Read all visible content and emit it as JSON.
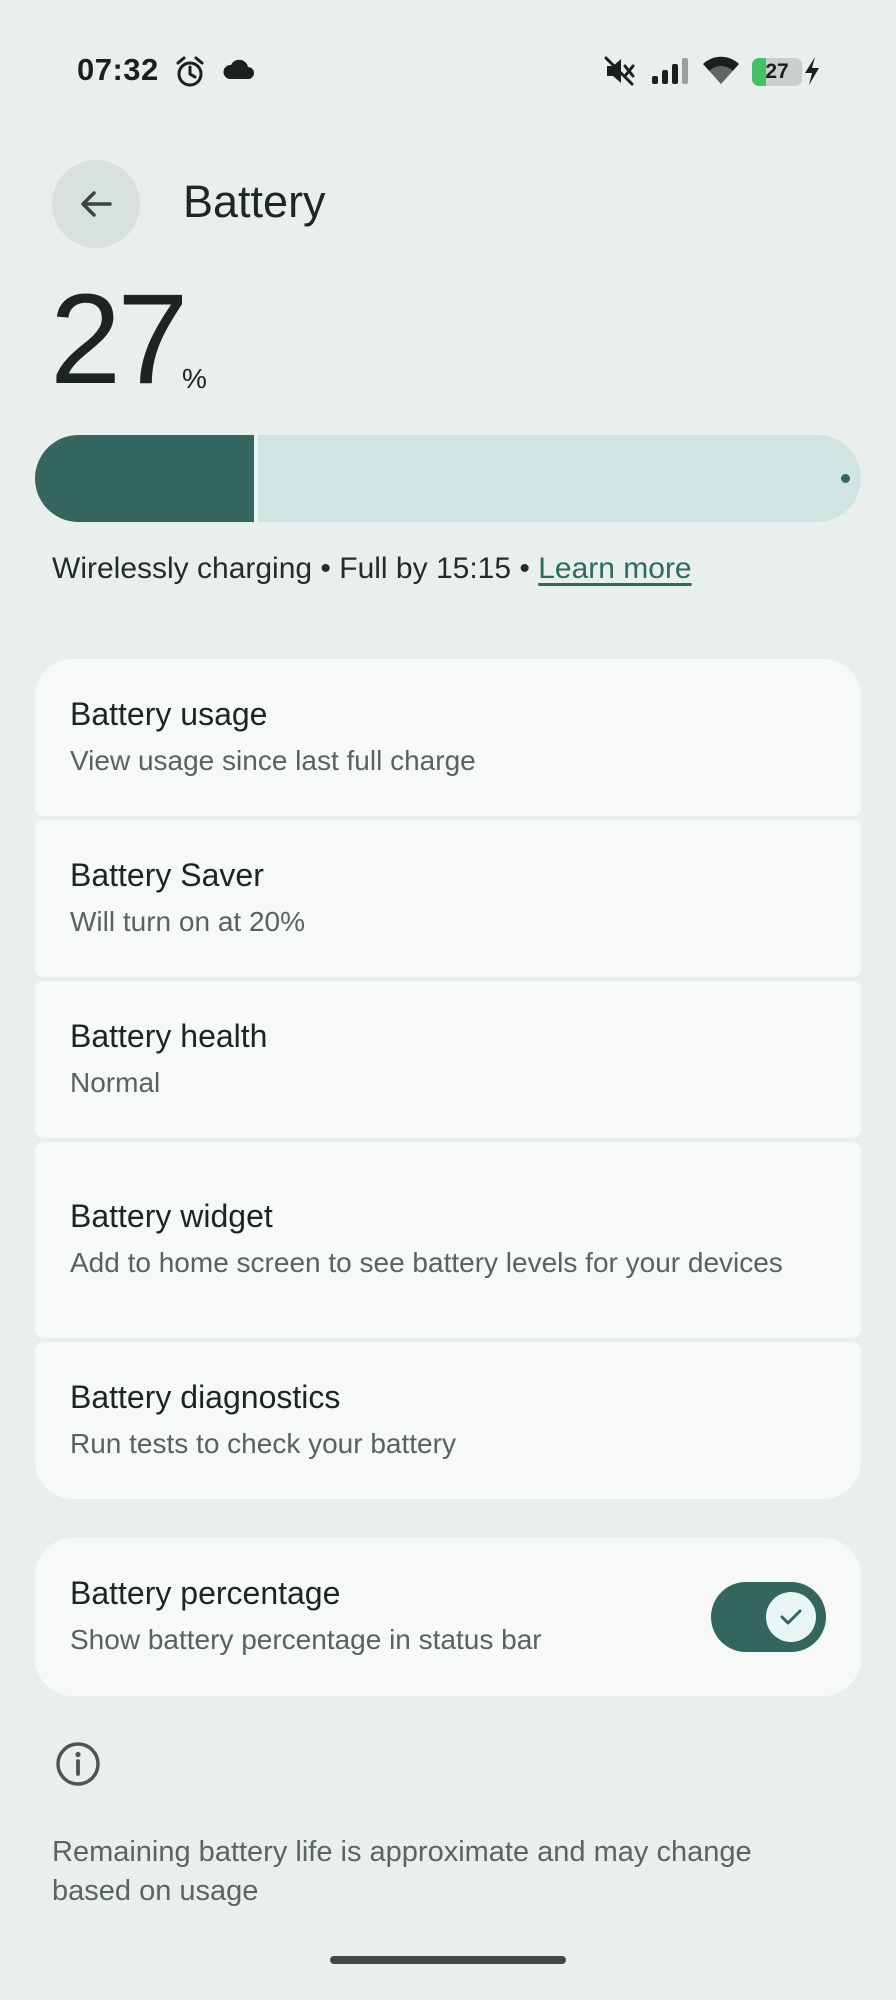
{
  "status_bar": {
    "time": "07:32",
    "battery_level": "27",
    "battery_fraction": 0.27,
    "icons": [
      "alarm-icon",
      "cloud-icon",
      "mute-icon",
      "signal-icon",
      "wifi-icon",
      "battery-icon",
      "charging-bolt-icon"
    ]
  },
  "header": {
    "back_icon": "arrow-back-icon",
    "title": "Battery"
  },
  "battery": {
    "level": "27",
    "unit": "%",
    "level_fraction": 0.27,
    "charge_status": "Wirelessly charging • Full by 15:15 • ",
    "learn_more": "Learn more"
  },
  "settings": [
    {
      "title": "Battery usage",
      "subtitle": "View usage since last full charge"
    },
    {
      "title": "Battery Saver",
      "subtitle": "Will turn on at 20%"
    },
    {
      "title": "Battery health",
      "subtitle": "Normal"
    },
    {
      "title": "Battery widget",
      "subtitle": "Add to home screen to see battery levels for your devices"
    },
    {
      "title": "Battery diagnostics",
      "subtitle": "Run tests to check your battery"
    }
  ],
  "battery_percentage": {
    "title": "Battery percentage",
    "subtitle": "Show battery percentage in status bar",
    "enabled": true
  },
  "footer": {
    "info_icon": "info-icon",
    "note": "Remaining battery life is approximate and may change based on usage"
  },
  "colors": {
    "accent": "#34655f",
    "background": "#e9efed",
    "card": "#f6f9f8",
    "meter_track": "#d0e5e2",
    "status_battery": "#44c06b"
  }
}
